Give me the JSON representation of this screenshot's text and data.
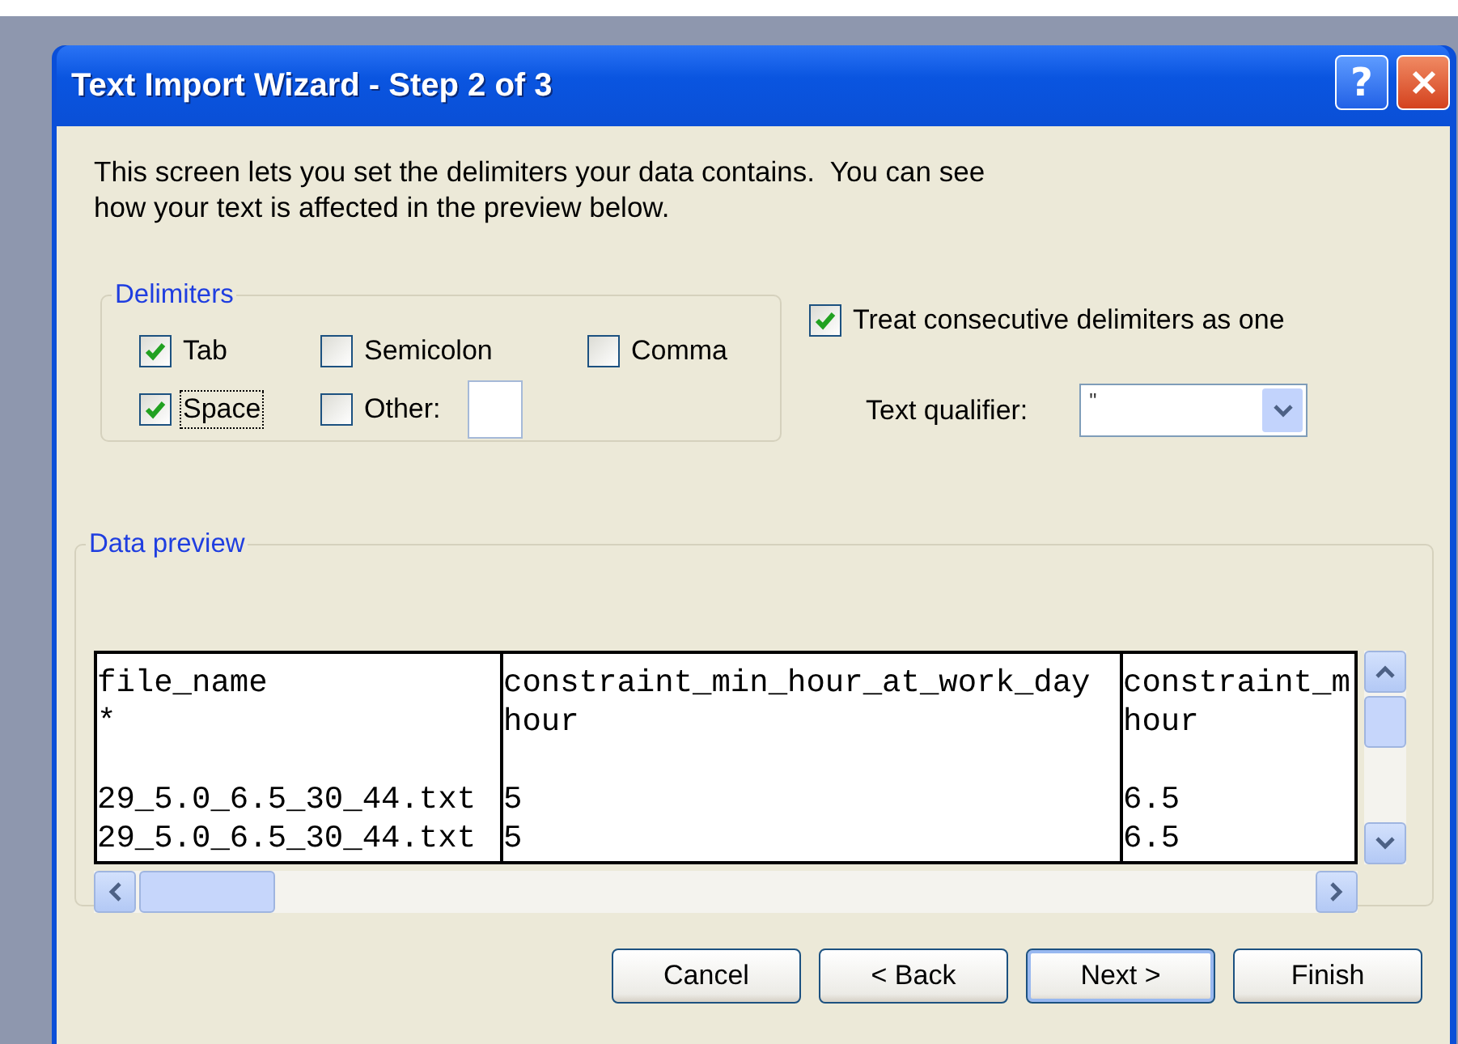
{
  "window": {
    "title": "Text Import Wizard - Step 2 of 3"
  },
  "title_buttons": [
    {
      "kind": "help",
      "label": "?"
    },
    {
      "kind": "close"
    }
  ],
  "intro": "This screen lets you set the delimiters your data contains.  You can see how your text is affected in the preview below.",
  "delimiters": {
    "label": "Delimiters",
    "items": [
      {
        "kind": "check",
        "label": "Tab",
        "checked": true,
        "focused": false
      },
      {
        "kind": "check",
        "label": "Semicolon",
        "checked": false,
        "focused": false
      },
      {
        "kind": "check",
        "label": "Comma",
        "checked": false,
        "focused": false
      },
      {
        "kind": "check",
        "label": "Space",
        "checked": true,
        "focused": true
      },
      {
        "kind": "other",
        "label": "Other:",
        "checked": false,
        "focused": false
      }
    ]
  },
  "consecutive": {
    "label": "Treat consecutive delimiters as one",
    "checked": true
  },
  "qualifier": {
    "label": "Text qualifier:",
    "value": "\""
  },
  "preview": {
    "label": "Data preview",
    "header_rows": [
      [
        "file_name",
        "constraint_min_hour_at_work_day",
        "constraint_m"
      ],
      [
        "*",
        "hour",
        "hour"
      ]
    ],
    "data_rows": [
      [
        "29_5.0_6.5_30_44.txt",
        "5",
        "6.5"
      ],
      [
        "29_5.0_6.5_30_44.txt",
        "5",
        "6.5"
      ]
    ]
  },
  "buttons": [
    {
      "label": "Cancel",
      "default": false
    },
    {
      "label": "< Back",
      "default": false
    },
    {
      "label": "Next >",
      "default": true
    },
    {
      "label": "Finish",
      "default": false
    }
  ]
}
